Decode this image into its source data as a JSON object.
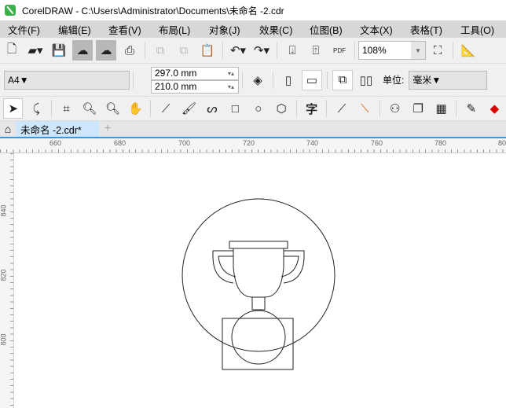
{
  "title": "CorelDRAW - C:\\Users\\Administrator\\Documents\\未命名 -2.cdr",
  "menu": [
    "文件(F)",
    "编辑(E)",
    "查看(V)",
    "布局(L)",
    "对象(J)",
    "效果(C)",
    "位图(B)",
    "文本(X)",
    "表格(T)",
    "工具(O)"
  ],
  "toolbar": {
    "zoom": "108%",
    "pdf": "PDF"
  },
  "property": {
    "page_size": "A4",
    "width": "297.0 mm",
    "height": "210.0 mm",
    "unit_label": "单位:",
    "unit": "毫米"
  },
  "tools": {
    "text_tool": "字"
  },
  "tab": {
    "label": "未命名 -2.cdr*"
  },
  "hruler": [
    "660",
    "680",
    "700",
    "720",
    "740",
    "760",
    "780",
    "80"
  ],
  "vruler": [
    "840",
    "820",
    "800"
  ]
}
